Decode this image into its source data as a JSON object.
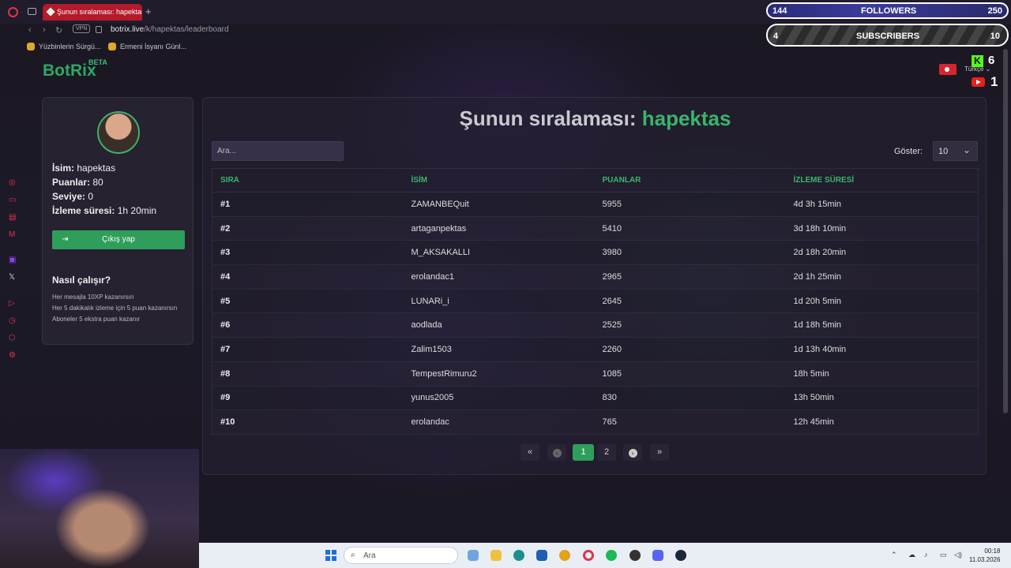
{
  "browser": {
    "tab_title": "Şunun sıralaması: hapektas",
    "url_host": "botrix.live",
    "url_path": "/k/hapektas/leaderboard",
    "vpn_label": "VPN",
    "bookmarks": [
      "Yüzbinlerin Sürgü...",
      "Ermeni İsyanı Günl..."
    ]
  },
  "brand": {
    "name": "BotRix",
    "badge": "BETA"
  },
  "profile": {
    "name_label": "İsim:",
    "name_value": "hapektas",
    "points_label": "Puanlar:",
    "points_value": "80",
    "level_label": "Seviye:",
    "level_value": "0",
    "watch_label": "İzleme süresi:",
    "watch_value": "1h 20min",
    "logout_label": "Çıkış yap",
    "how_title": "Nasıl çalışır?",
    "how_items": [
      "Her mesajla 10XP kazanırsın",
      "Her 5 dakikalık izleme için 5 puan kazanırsın",
      "Aboneler 5 ekstra puan kazanır"
    ]
  },
  "leaderboard": {
    "title_prefix": "Şunun sıralaması:",
    "title_name": "hapektas",
    "search_placeholder": "Ara...",
    "show_label": "Göster:",
    "show_value": "10",
    "columns": [
      "SIRA",
      "İSİM",
      "PUANLAR",
      "İZLEME SÜRESİ"
    ],
    "rows": [
      {
        "rank": "#1",
        "name": "ZAMANBEQuit",
        "points": "5955",
        "watch": "4d 3h 15min"
      },
      {
        "rank": "#2",
        "name": "artaganpektas",
        "points": "5410",
        "watch": "3d 18h 10min"
      },
      {
        "rank": "#3",
        "name": "M_AKSAKALLI",
        "points": "3980",
        "watch": "2d 18h 20min"
      },
      {
        "rank": "#4",
        "name": "erolandac1",
        "points": "2965",
        "watch": "2d 1h 25min"
      },
      {
        "rank": "#5",
        "name": "LUNARi_i",
        "points": "2645",
        "watch": "1d 20h 5min"
      },
      {
        "rank": "#6",
        "name": "aodlada",
        "points": "2525",
        "watch": "1d 18h 5min"
      },
      {
        "rank": "#7",
        "name": "Zalim1503",
        "points": "2260",
        "watch": "1d 13h 40min"
      },
      {
        "rank": "#8",
        "name": "TempestRimuru2",
        "points": "1085",
        "watch": "18h 5min"
      },
      {
        "rank": "#9",
        "name": "yunus2005",
        "points": "830",
        "watch": "13h 50min"
      },
      {
        "rank": "#10",
        "name": "erolandac",
        "points": "765",
        "watch": "12h 45min"
      }
    ],
    "pages": [
      "1",
      "2"
    ],
    "current_page": "1"
  },
  "language": {
    "label": "Türkçe"
  },
  "stream_overlay": {
    "followers_label": "FOLLOWERS",
    "followers_count": "144",
    "followers_goal": "250",
    "subscribers_label": "SUBSCRIBERS",
    "subscribers_count": "4",
    "subscribers_goal": "10",
    "kick_count": "6",
    "youtube_count": "1"
  },
  "taskbar": {
    "search_placeholder": "Ara",
    "time": "00:18",
    "date": "11.03.2026"
  }
}
